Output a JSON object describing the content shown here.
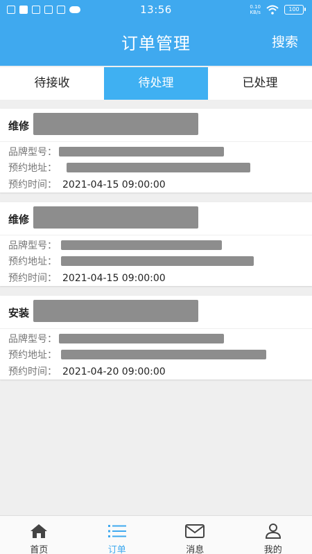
{
  "status_bar": {
    "time": "13:56",
    "net_speed_value": "0.10",
    "net_speed_unit": "KB/s",
    "battery": "100"
  },
  "header": {
    "title": "订单管理",
    "search_label": "搜索"
  },
  "tabs": [
    {
      "label": "待接收",
      "active": false
    },
    {
      "label": "待处理",
      "active": true
    },
    {
      "label": "已处理",
      "active": false
    }
  ],
  "orders": [
    {
      "type": "维修",
      "brand_label": "品牌型号：",
      "address_label": "预约地址：",
      "time_label": "预约时间：",
      "time_value": "2021-04-15 09:00:00"
    },
    {
      "type": "维修",
      "brand_label": "品牌型号：",
      "address_label": "预约地址：",
      "time_label": "预约时间：",
      "time_value": "2021-04-15 09:00:00"
    },
    {
      "type": "安装",
      "brand_label": "品牌型号：",
      "address_label": "预约地址：",
      "time_label": "预约时间：",
      "time_value": "2021-04-20 09:00:00"
    }
  ],
  "bottom_nav": [
    {
      "label": "首页",
      "icon": "home-icon",
      "active": false
    },
    {
      "label": "订单",
      "icon": "list-icon",
      "active": true
    },
    {
      "label": "消息",
      "icon": "mail-icon",
      "active": false
    },
    {
      "label": "我的",
      "icon": "user-icon",
      "active": false
    }
  ],
  "colors": {
    "primary": "#3fa9ef",
    "tab_active": "#3fb0f2",
    "redaction": "#8d8d8d",
    "background": "#efefef"
  }
}
